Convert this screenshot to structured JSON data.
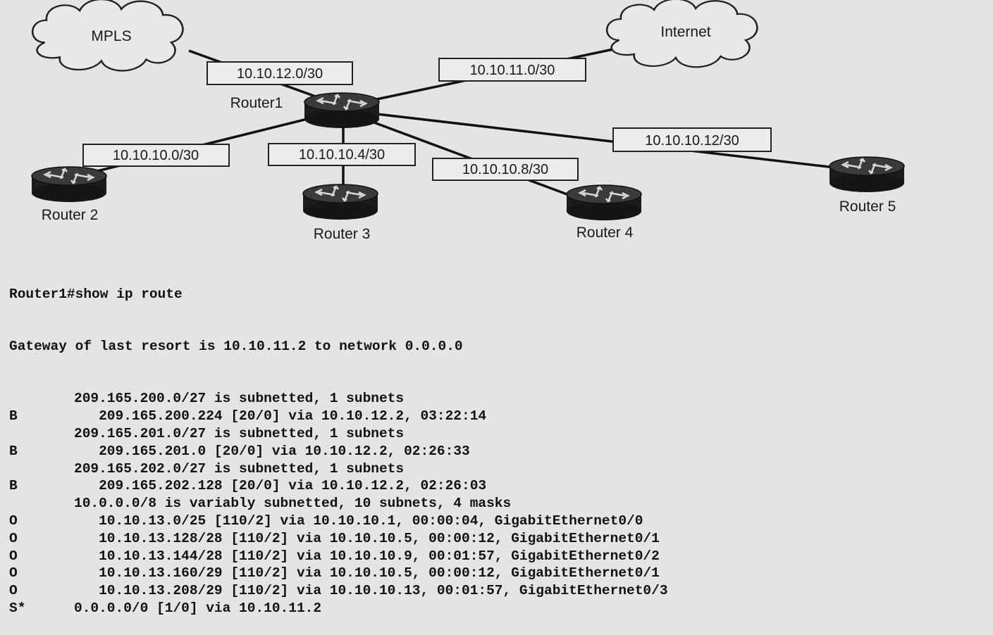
{
  "clouds": {
    "mpls": "MPLS",
    "internet": "Internet"
  },
  "routers": {
    "r1": "Router1",
    "r2": "Router 2",
    "r3": "Router 3",
    "r4": "Router 4",
    "r5": "Router 5"
  },
  "subnets": {
    "mpls_link": "10.10.12.0/30",
    "internet_link": "10.10.11.0/30",
    "r2_link": "10.10.10.0/30",
    "r3_link": "10.10.10.4/30",
    "r4_link": "10.10.10.8/30",
    "r5_link": "10.10.10.12/30"
  },
  "cli": {
    "command": "Router1#show ip route",
    "gateway": "Gateway of last resort is 10.10.11.2 to network 0.0.0.0",
    "rows": [
      {
        "code": "",
        "text": "209.165.200.0/27 is subnetted, 1 subnets"
      },
      {
        "code": "B",
        "text": "   209.165.200.224 [20/0] via 10.10.12.2, 03:22:14"
      },
      {
        "code": "",
        "text": "209.165.201.0/27 is subnetted, 1 subnets"
      },
      {
        "code": "B",
        "text": "   209.165.201.0 [20/0] via 10.10.12.2, 02:26:33"
      },
      {
        "code": "",
        "text": "209.165.202.0/27 is subnetted, 1 subnets"
      },
      {
        "code": "B",
        "text": "   209.165.202.128 [20/0] via 10.10.12.2, 02:26:03"
      },
      {
        "code": "",
        "text": "10.0.0.0/8 is variably subnetted, 10 subnets, 4 masks"
      },
      {
        "code": "O",
        "text": "   10.10.13.0/25 [110/2] via 10.10.10.1, 00:00:04, GigabitEthernet0/0"
      },
      {
        "code": "O",
        "text": "   10.10.13.128/28 [110/2] via 10.10.10.5, 00:00:12, GigabitEthernet0/1"
      },
      {
        "code": "O",
        "text": "   10.10.13.144/28 [110/2] via 10.10.10.9, 00:01:57, GigabitEthernet0/2"
      },
      {
        "code": "O",
        "text": "   10.10.13.160/29 [110/2] via 10.10.10.5, 00:00:12, GigabitEthernet0/1"
      },
      {
        "code": "O",
        "text": "   10.10.13.208/29 [110/2] via 10.10.10.13, 00:01:57, GigabitEthernet0/3"
      },
      {
        "code": "S*",
        "text": "0.0.0.0/0 [1/0] via 10.10.11.2"
      }
    ]
  }
}
